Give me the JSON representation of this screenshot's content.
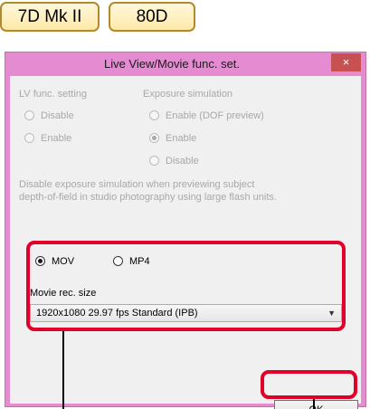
{
  "models": {
    "tab1": "7D Mk II",
    "tab2": "80D"
  },
  "dialog": {
    "title": "Live View/Movie func. set.",
    "close_glyph": "×",
    "lv_func": {
      "label": "LV func. setting",
      "options": [
        "Disable",
        "Enable"
      ]
    },
    "exposure_sim": {
      "label": "Exposure simulation",
      "options": [
        "Enable (DOF preview)",
        "Enable",
        "Disable"
      ],
      "selected": "Enable"
    },
    "note": [
      "Disable exposure simulation when previewing subject",
      "depth-of-field in studio photography using large flash units."
    ],
    "movie_format": {
      "options": [
        "MOV",
        "MP4"
      ],
      "selected": "MOV"
    },
    "movie_rec_size": {
      "label": "Movie rec. size",
      "value": "1920x1080  29.97 fps Standard (IPB)"
    },
    "ok_label": "OK"
  },
  "colors": {
    "titlebar": "#e48bd1",
    "close_button": "#c75050",
    "highlight": "#e0002a",
    "tab_border": "#b38a2a",
    "tab_fill": "#fde9a8"
  }
}
